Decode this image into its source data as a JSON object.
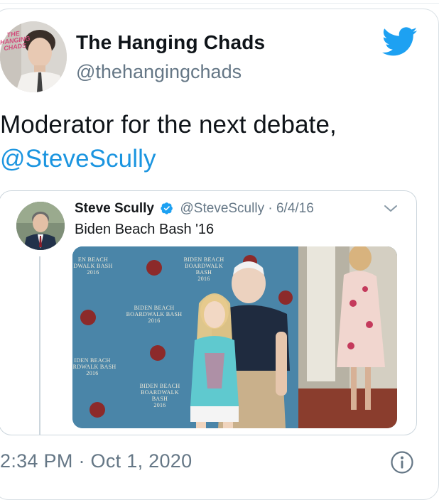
{
  "author": {
    "name": "The Hanging Chads",
    "handle": "@thehangingchads",
    "avatar_brand_text": "THE HANGING CHADS"
  },
  "tweet": {
    "text": "Moderator for the next debate,",
    "mention": "@SteveScully"
  },
  "quoted_tweet": {
    "name": "Steve Scully",
    "handle": "@SteveScully",
    "separator": "·",
    "date": "6/4/16",
    "text": "Biden Beach Bash '16",
    "photo_backdrop_text": [
      "BIDEN BEACH",
      "BOARDWALK BASH",
      "2016"
    ]
  },
  "footer": {
    "timestamp": "2:34 PM · Oct 1, 2020"
  },
  "colors": {
    "accent": "#1da1f2",
    "link": "#1b95e0",
    "secondary_text": "#657786",
    "border": "#ccd6dd"
  },
  "icons": [
    "twitter-bird-icon",
    "verified-badge-icon",
    "chevron-down-icon",
    "info-icon"
  ]
}
